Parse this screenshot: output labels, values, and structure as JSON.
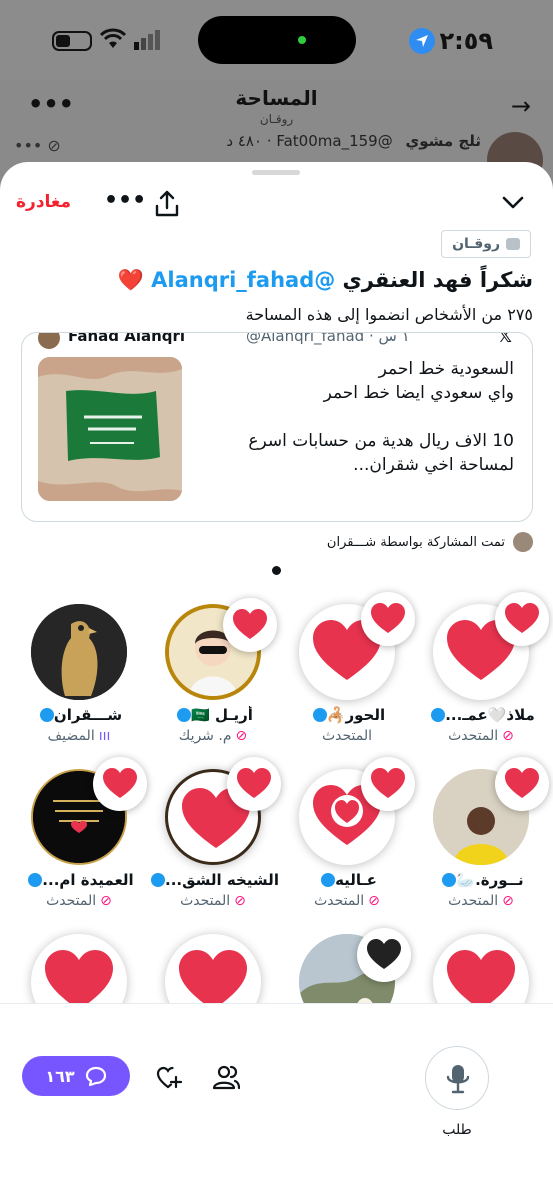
{
  "status_bar": {
    "time": "٢:٥٩"
  },
  "background": {
    "title": "المساحة",
    "subtitle": "روقـان",
    "row_name": "ثلج مشوي",
    "row_handle": "@Fat00ma_159 · ٤٨٠ د"
  },
  "sheet": {
    "leave_label": "مغادرة",
    "topic": "روقـان",
    "title_text": "شكراً فهد العنقري ",
    "title_mention": "@Alanqri_fahad",
    "title_emoji": "❤️",
    "joined_text": "٢٧٥ من الأشخاص انضموا إلى هذه المساحة"
  },
  "tweet": {
    "author_name": "Fahad Alanqri",
    "author_handle": "@Alanqri_fahad · ١ س",
    "lines": [
      "السعودية خط احمر",
      "واي سعودي ايضا خط احمر",
      "",
      "10 الاف ريال هدية من حسابات اسرع",
      "لمساحة  اخي شقران..."
    ]
  },
  "shared_by": "تمت المشاركة بواسطة شـــقران",
  "participants": [
    {
      "name": "ملاذ🤍عمـ...",
      "role": "المتحدث",
      "verified": true
    },
    {
      "name": "الحور🦂",
      "role": "المتحدث",
      "verified": true
    },
    {
      "name": "أريـل 🇸🇦",
      "role": "م. شريك",
      "verified": true
    },
    {
      "name": "شـــقران",
      "role": "المضيف",
      "verified": true
    },
    {
      "name": "نــورة.🦢",
      "role": "المتحدث",
      "verified": true
    },
    {
      "name": "عـاليه",
      "role": "المتحدث",
      "verified": true
    },
    {
      "name": "الشيخه الشق...",
      "role": "المتحدث",
      "verified": true
    },
    {
      "name": "العميدة ام...",
      "role": "المتحدث",
      "verified": true
    }
  ],
  "bottom": {
    "reply_count": "١٦٣",
    "request_label": "طلب"
  },
  "colors": {
    "accent": "#1d9bf0",
    "heart": "#e0245e",
    "purple": "#7856ff",
    "leave": "#f4212e"
  }
}
